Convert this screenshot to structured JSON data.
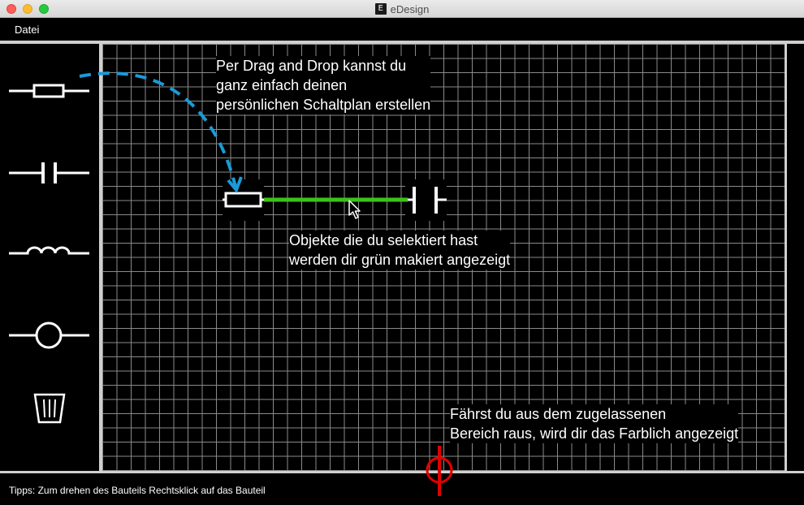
{
  "window": {
    "title": "eDesign",
    "app_icon_glyph": "E"
  },
  "menu": {
    "items": [
      "Datei"
    ]
  },
  "palette": {
    "items": [
      {
        "name": "resistor",
        "icon": "resistor-icon"
      },
      {
        "name": "capacitor",
        "icon": "capacitor-icon"
      },
      {
        "name": "inductor",
        "icon": "inductor-icon"
      },
      {
        "name": "lamp",
        "icon": "lamp-icon"
      },
      {
        "name": "trash",
        "icon": "trash-icon"
      }
    ]
  },
  "tips": {
    "drag_drop": [
      "Per Drag and Drop kannst du",
      "ganz einfach deinen",
      "persönlichen Schaltplan erstellen"
    ],
    "selected": [
      "Objekte die du selektiert hast",
      "werden dir grün makiert angezeigt"
    ],
    "out_of_bounds": [
      "Fährst du aus dem zugelassenen",
      "Bereich raus, wird dir das Farblich angezeigt"
    ]
  },
  "colors": {
    "selected": "#3cc21a",
    "out_of_bounds": "#e00000",
    "drag_arrow": "#1a9bd7",
    "grid_line": "#8a8a8a",
    "divider": "#cfcfcf"
  },
  "status": {
    "text": "Tipps: Zum drehen des Bauteils Rechtsklick auf das Bauteil"
  }
}
